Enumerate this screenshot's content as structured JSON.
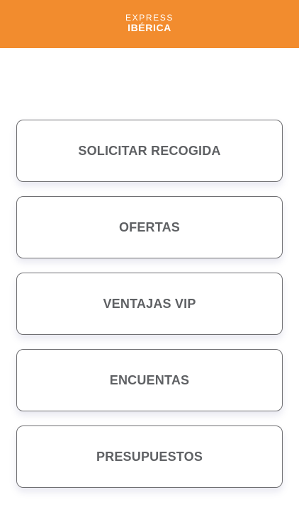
{
  "header": {
    "brand_top": "EXPRESS",
    "brand_bottom": "IBÉRICA",
    "background_color": "#f28c2e"
  },
  "menu": {
    "items": [
      {
        "label": "SOLICITAR RECOGIDA"
      },
      {
        "label": "OFERTAS"
      },
      {
        "label": "VENTAJAS VIP"
      },
      {
        "label": "ENCUENTAS"
      },
      {
        "label": "PRESUPUESTOS"
      }
    ]
  }
}
